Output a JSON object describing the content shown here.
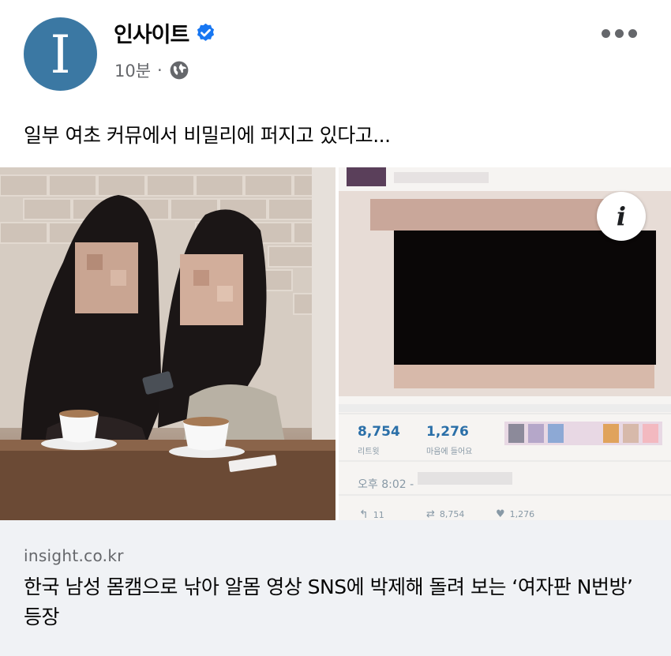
{
  "header": {
    "page_name": "인사이트",
    "avatar_letter": "I",
    "time": "10분",
    "separator": "·",
    "verified_icon": "verified-badge-icon",
    "audience_icon": "globe-icon",
    "more_icon": "more-options-icon"
  },
  "post": {
    "text": "일부 여초 커뮤에서 비밀리에 퍼지고 있다고..."
  },
  "media": {
    "info_label": "i",
    "tweet": {
      "retweets_count": "8,754",
      "retweets_label": "리트윗",
      "likes_count": "1,276",
      "likes_label": "마음에 들어요",
      "time": "오후 8:02 -",
      "reply_count": "11",
      "retweet_count_small": "8,754",
      "like_count_small": "1,276"
    }
  },
  "link": {
    "domain": "insight.co.kr",
    "title": "한국 남성 몸캠으로 낚아 알몸 영상 SNS에 박제해 돌려 보는 ‘여자판 N번방’ 등장"
  },
  "colors": {
    "avatar_bg": "#3b78a3",
    "verified": "#1877f2",
    "secondary_text": "#65676b",
    "link_box_bg": "#f0f2f5",
    "tweet_count_blue": "#2a6fa8"
  }
}
